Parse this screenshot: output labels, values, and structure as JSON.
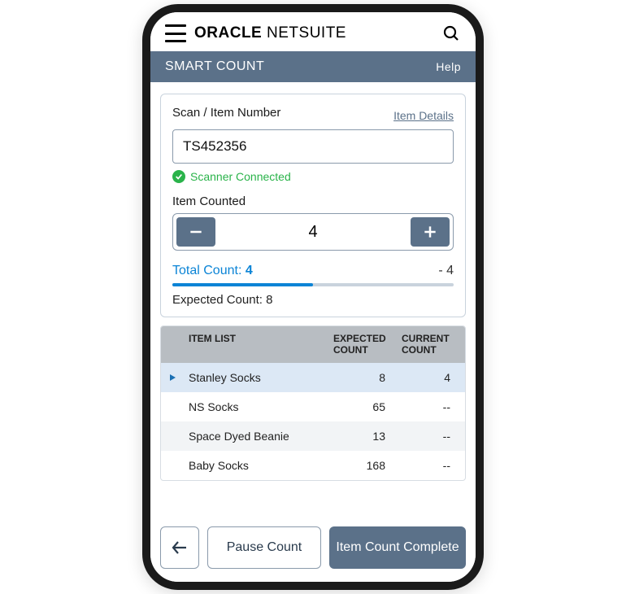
{
  "brand": {
    "strong": "ORACLE",
    "light": "NETSUITE"
  },
  "section": {
    "title": "SMART COUNT",
    "help": "Help"
  },
  "scan": {
    "label": "Scan / Item Number",
    "details_link": "Item Details",
    "value": "TS452356",
    "scanner_status": "Scanner Connected"
  },
  "counted": {
    "label": "Item Counted",
    "value": "4"
  },
  "totals": {
    "total_label": "Total Count:",
    "total_value": "4",
    "variance": "- 4",
    "expected_label": "Expected Count:",
    "expected_value": "8",
    "progress_percent": 50
  },
  "table": {
    "headers": {
      "item": "ITEM LIST",
      "expected": "EXPECTED COUNT",
      "current": "CURRENT COUNT"
    },
    "rows": [
      {
        "name": "Stanley Socks",
        "expected": "8",
        "current": "4",
        "active": true
      },
      {
        "name": "NS Socks",
        "expected": "65",
        "current": "--",
        "active": false
      },
      {
        "name": "Space Dyed Beanie",
        "expected": "13",
        "current": "--",
        "active": false
      },
      {
        "name": "Baby Socks",
        "expected": "168",
        "current": "--",
        "active": false
      }
    ]
  },
  "footer": {
    "pause": "Pause Count",
    "complete": "Item Count Complete"
  }
}
